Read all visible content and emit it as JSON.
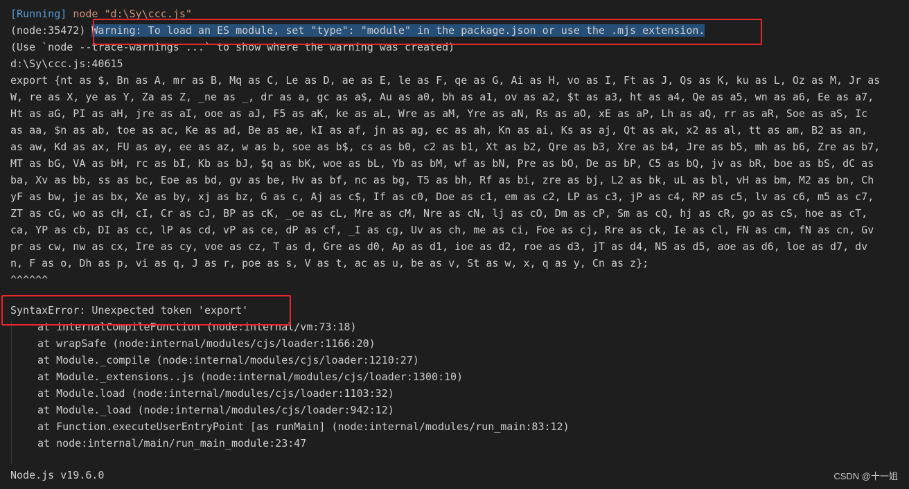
{
  "output": {
    "run_status": "[Running]",
    "run_command": "node \"d:\\Sy\\ccc.js\"",
    "warning_prefix": "(node:35472) ",
    "warning_message": "Warning: To load an ES module, set \"type\": \"module\" in the package.json or use the .mjs extension.",
    "trace_hint": "(Use `node --trace-warnings ...` to show where the warning was created)",
    "file_location": "d:\\Sy\\ccc.js:40615",
    "export_lines": [
      "export {nt as $, Bn as A, mr as B, Mq as C, Le as D, ae as E, le as F, qe as G, Ai as H, vo as I, Ft as J, Qs as K, ku as L, Oz as M, Jr as",
      "W, re as X, ye as Y, Za as Z, _ne as _, dr as a, gc as a$, Au as a0, bh as a1, ov as a2, $t as a3, ht as a4, Qe as a5, wn as a6, Ee as a7,",
      "Ht as aG, PI as aH, jre as aI, ooe as aJ, F5 as aK, ke as aL, Wre as aM, Yre as aN, Rs as aO, xE as aP, Lh as aQ, rr as aR, Soe as aS, Ic",
      "as aa, $n as ab, toe as ac, Ke as ad, Be as ae, kI as af, jn as ag, ec as ah, Kn as ai, Ks as aj, Qt as ak, x2 as al, tt as am, B2 as an,",
      "as aw, Kd as ax, FU as ay, ee as az, w as b, soe as b$, cs as b0, c2 as b1, Xt as b2, Qre as b3, Xre as b4, Jre as b5, mh as b6, Zre as b7,",
      "MT as bG, VA as bH, rc as bI, Kb as bJ, $q as bK, woe as bL, Yb as bM, wf as bN, Pre as bO, De as bP, C5 as bQ, jv as bR, boe as bS, dC as",
      "ba, Xv as bb, ss as bc, Eoe as bd, gv as be, Hv as bf, nc as bg, T5 as bh, Rf as bi, zre as bj, L2 as bk, uL as bl, vH as bm, M2 as bn, Ch",
      "yF as bw, je as bx, Xe as by, xj as bz, G as c, Aj as c$, If as c0, Doe as c1, em as c2, LP as c3, jP as c4, RP as c5, lv as c6, m5 as c7,",
      "ZT as cG, wo as cH, cI, Cr as cJ, BP as cK, _oe as cL, Mre as cM, Nre as cN, lj as cO, Dm as cP, Sm as cQ, hj as cR, go as cS, hoe as cT,",
      "ca, YP as cb, DI as cc, lP as cd, vP as ce, dP as cf, _I as cg, Uv as ch, me as ci, Foe as cj, Rre as ck, Ie as cl, FN as cm, fN as cn, Gv",
      "pr as cw, nw as cx, Ire as cy, voe as cz, T as d, Gre as d0, Ap as d1, ioe as d2, roe as d3, jT as d4, N5 as d5, aoe as d6, loe as d7, dv",
      "n, F as o, Dh as p, vi as q, J as r, poe as s, V as t, ac as u, be as v, St as w, x, q as y, Cn as z};"
    ],
    "caret_marker": "^^^^^^",
    "error_message": "SyntaxError: Unexpected token 'export'",
    "stack_trace": [
      "at internalCompileFunction (node:internal/vm:73:18)",
      "at wrapSafe (node:internal/modules/cjs/loader:1166:20)",
      "at Module._compile (node:internal/modules/cjs/loader:1210:27)",
      "at Module._extensions..js (node:internal/modules/cjs/loader:1300:10)",
      "at Module.load (node:internal/modules/cjs/loader:1103:32)",
      "at Module._load (node:internal/modules/cjs/loader:942:12)",
      "at Function.executeUserEntryPoint [as runMain] (node:internal/modules/run_main:83:12)",
      "at node:internal/main/run_main_module:23:47"
    ],
    "node_version": "Node.js v19.6.0"
  },
  "watermark": "CSDN @十一姐",
  "colors": {
    "background": "#1e1e1e",
    "text": "#cccccc",
    "running_status": "#569cd6",
    "command": "#ce9178",
    "selection": "#264f78",
    "highlight_box": "#e8262b"
  }
}
